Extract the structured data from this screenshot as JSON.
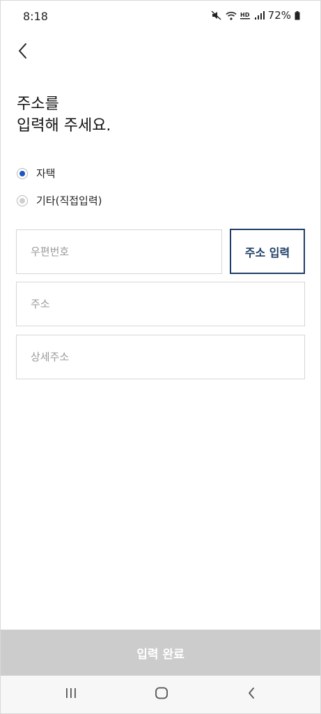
{
  "status_bar": {
    "time": "8:18",
    "battery": "72%"
  },
  "page": {
    "title_line1": "주소를",
    "title_line2": "입력해 주세요."
  },
  "address_type": {
    "options": [
      {
        "label": "자택",
        "selected": true
      },
      {
        "label": "기타(직접입력)",
        "selected": false
      }
    ]
  },
  "form": {
    "zip_placeholder": "우편번호",
    "zip_value": "",
    "address_placeholder": "주소",
    "address_value": "",
    "detail_placeholder": "상세주소",
    "detail_value": "",
    "search_button_label": "주소 입력"
  },
  "footer": {
    "submit_label": "입력 완료",
    "submit_enabled": false
  },
  "colors": {
    "accent": "#1a56c4",
    "button_border": "#1d3d66",
    "disabled_button": "#cccccc"
  },
  "icons": {
    "back": "chevron-left-icon",
    "nav_recents": "recents-icon",
    "nav_home": "home-icon",
    "nav_back": "back-icon"
  }
}
